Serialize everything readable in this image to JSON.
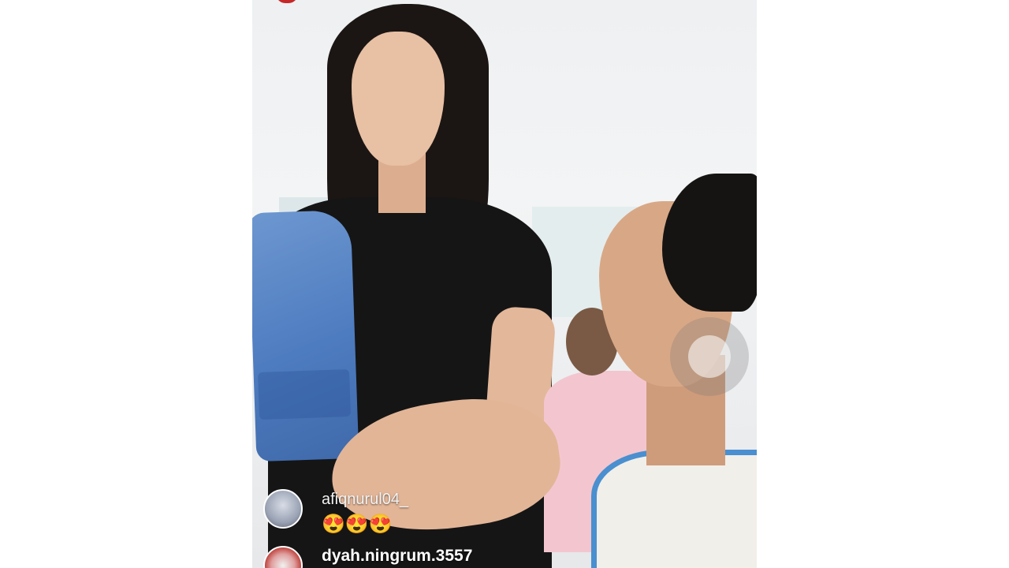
{
  "stream": {
    "comments": [
      {
        "username": "afiqnurul04_",
        "message": "😍😍😍"
      },
      {
        "username": "dyah.ningrum.3557",
        "message": ""
      }
    ],
    "record_button": {
      "icon": "record-icon"
    },
    "live_indicator": {
      "color": "#c62828"
    },
    "colors": {
      "username_text": "#f3f3f3",
      "towel": "#4e7cc0"
    }
  }
}
